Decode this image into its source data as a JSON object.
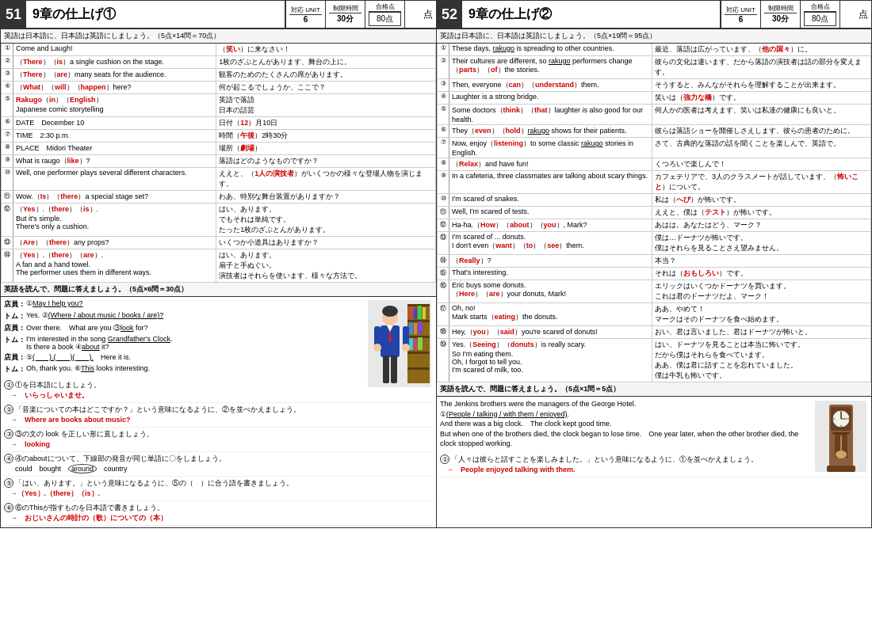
{
  "left": {
    "number": "51",
    "title": "9章の仕上げ①",
    "unit": "6",
    "time": "30分",
    "score": "80点",
    "section1": {
      "label": "英語は日本語に、日本語は英語にしましょう。（5点×14問＝70点）",
      "rows": [
        {
          "num": "①",
          "en": "Come and Laugh!",
          "ja": "（笑い）に来なさい！"
        },
        {
          "num": "②",
          "en": "（There）（is）a single cushion on the stage.",
          "ja": "1枚のざぶとんがあります、舞台の上に。"
        },
        {
          "num": "③",
          "en": "（There）（are）many seats for the audience.",
          "ja": "観客のためのたくさんの席があります。"
        },
        {
          "num": "④",
          "en": "（What）（will）（happen）here?",
          "ja": "何が起こるでしょうか、ここで？"
        },
        {
          "num": "⑤",
          "en": "Rakugo（in）（English）\nJapanese comic storytelling",
          "ja": "英語で落語\n日本の話芸"
        },
        {
          "num": "⑥",
          "en": "DATE　December 10",
          "ja": "日付（12）月10日"
        },
        {
          "num": "⑦",
          "en": "TIME　2:30 p.m.",
          "ja": "時間（午後）2時30分"
        },
        {
          "num": "⑧",
          "en": "PLACE　Midori Theater",
          "ja": "場所（劇場）"
        },
        {
          "num": "⑨",
          "en": "What is raugo（like）?",
          "ja": "落語はどのようなものですか？"
        },
        {
          "num": "⑩",
          "en": "Well, one performer plays several different characters.",
          "ja": "ええと、（1人の演技者）がいくつかの様々な登場人物を演じます。"
        },
        {
          "num": "⑪",
          "en": "Wow.（Is）（there）a special stage set?",
          "ja": "わあ、特別な舞台装置がありますか？"
        },
        {
          "num": "⑫",
          "en": "（Yes）.（there）（is）.\nBut it's simple.\nThere's only a cushion.",
          "ja": "はい、あります。\nでもそれは単純です。\nたった1枚のざぶとんがあります。"
        },
        {
          "num": "⑬",
          "en": "（Are）（there）any props?",
          "ja": "いくつか小道具はありますか？"
        },
        {
          "num": "⑭",
          "en": "（Yes）.（there）（are）.\nA fan and a hand towel.\nThe performer uses them in different ways.",
          "ja": "はい、あります。\n扇子と手ぬぐい。\n演技者はそれらを使います、様々な方法で。"
        }
      ]
    },
    "section2": {
      "label": "英語を読んで、問題に答えましょう。（5点×6問＝30点）",
      "dialogue": [
        {
          "speaker": "店員：",
          "text": "①May I help you?"
        },
        {
          "speaker": "トム：",
          "text": "Yes. ②(Where / about music / books / are)?"
        },
        {
          "speaker": "店員：",
          "text": "Over there.　What are you ③look for?"
        },
        {
          "speaker": "トム：",
          "text": "I'm interested in the song Grandfather's Clock.\nIs there a book ④about it?"
        },
        {
          "speaker": "店員：",
          "text": "⑤(　　).( 　 )(　　).　Here it is."
        },
        {
          "speaker": "トム：",
          "text": "Oh, thank you. ⑥This looks interesting."
        }
      ],
      "questions": [
        {
          "num": "①",
          "text": "①を日本語にしましょう。",
          "answer": "→　いらっしゃいませ。"
        },
        {
          "num": "②",
          "text": "「音楽についての本はどこですか？」という意味になるように、②を並べかえましょう。",
          "answer": "→　Where are books about music?"
        },
        {
          "num": "③",
          "text": "③の文の look を正しい形に直しましょう。",
          "answer": "→　looking"
        },
        {
          "num": "④",
          "text": "④のaboutについて、下線部の発音が同じ単語に〇をしましょう。",
          "answer": "could　bought　around　country"
        },
        {
          "num": "⑤",
          "text": "「はい、あります。」という意味になるように、⑤の（　）に合う語を書きましょう。",
          "answer": "→（Yes）.（there）（is）."
        },
        {
          "num": "⑥",
          "text": "⑥のThisが指すものを日本語で書きましょう。",
          "answer": "→　おじいさんの時計の（歌）についての（本）"
        }
      ]
    }
  },
  "right": {
    "number": "52",
    "title": "9章の仕上げ②",
    "unit": "6",
    "time": "30分",
    "score": "80点",
    "section1": {
      "label": "英語は日本語に、日本語は英語にしましょう。（5点×19問＝95点）",
      "rows": [
        {
          "num": "①",
          "en": "These days, rakugo is spreading to other countries.",
          "ja": "最近、落語は広がっています、（他の国々）に。"
        },
        {
          "num": "②",
          "en": "Their cultures are different, so rakugo performers change（parts）（of）the stories.",
          "ja": "彼らの文化は違います、だから落語の演技者は話の部分を変えます。"
        },
        {
          "num": "③",
          "en": "Then, everyone（can）（understand）them.",
          "ja": "そうすると、みんながそれらを理解することが出来ます。"
        },
        {
          "num": "④",
          "en": "Laughter is a strong bridge.",
          "ja": "笑いは（強力な橋）です。"
        },
        {
          "num": "⑤",
          "en": "Some doctors（think）（that）laughter is also good for our health.",
          "ja": "何人かの医者は考えます、笑いは私達の健康にも良いと。"
        },
        {
          "num": "⑥",
          "en": "They（even）（hold）rakugo shows for their patients.",
          "ja": "彼らは落語ショーを開催しさえします、彼らの患者のために。"
        },
        {
          "num": "⑦",
          "en": "Now, enjoy（listening）to some classic rakugo stories in English.",
          "ja": "さて、古典的な落語の話を聞くことを楽しんで、英語で。"
        },
        {
          "num": "⑧",
          "en": "（Relax）and have fun!",
          "ja": "くつろいで楽しんで！"
        },
        {
          "num": "⑨",
          "en": "In a cafeteria, three classmates are talking about scary things.",
          "ja": "カフェテリアで、3人のクラスメートが話しています、（怖いこと）について。"
        },
        {
          "num": "⑩",
          "en": "I'm scared of snakes.",
          "ja": "私は（へび）が怖いです。"
        },
        {
          "num": "⑪",
          "en": "Well, I'm scared of tests.",
          "ja": "ええと、僕は（テスト）が怖いです。"
        },
        {
          "num": "⑫",
          "en": "Ha-ha.（How）（about）（you）, Mark?",
          "ja": "あはは。あなたはどう、マーク？"
        },
        {
          "num": "⑬",
          "en": "I'm scared of ... donuts.\nI don't even（want）（to）（see）them.",
          "ja": "僕は…ドーナツが怖いです。\n僕はそれらを見ることさえ望みません。"
        },
        {
          "num": "⑭",
          "en": "（Really）?",
          "ja": "本当？"
        },
        {
          "num": "⑮",
          "en": "That's interesting.",
          "ja": "それは（おもしろい）です。"
        },
        {
          "num": "⑯",
          "en": "Eric buys some donuts.\n（Here）（are）your donuts, Mark!",
          "ja": "エリックはいくつかドーナツを買います。\nこれは君のドーナツだよ、マーク！"
        },
        {
          "num": "⑰",
          "en": "Oh, no!\nMark starts（eating）the donuts.",
          "ja": "ああ、やめて！\nマークはそのドーナツを食べ始めます。"
        },
        {
          "num": "⑱",
          "en": "Hey,（you）（said）you're scared of donuts!",
          "ja": "おい、君は言いました、君はドーナツが怖いと。"
        },
        {
          "num": "⑲",
          "en": "Yes.（Seeing）（donuts）is really scary.\nSo I'm eating them.\nOh, I forgot to tell you.\nI'm scared of milk, too.",
          "ja": "はい、ドーナツを見ることは本当に怖いです。\nだから僕はそれらを食べています。\nああ、僕は君に話すことを忘れていました。\n僕は牛乳も怖いです。"
        }
      ]
    },
    "section2": {
      "label": "英語を読んで、問題に答えましょう。（5点×1問＝5点）",
      "passage": "The Jenkins brothers were the managers of the George Hotel.\n①(People / talking / with them / enjoyed).\nAnd there was a big clock. The clock kept good time.\nBut when one of the brothers died, the clock began to lose time. One year later, when the other brother died, the clock stopped working.",
      "questions": [
        {
          "num": "①",
          "text": "「人々は彼らと話すことを楽しみました。」という意味になるように、①を並べかえましょう。",
          "answer": "→　People enjoyed talking with them."
        }
      ]
    }
  }
}
